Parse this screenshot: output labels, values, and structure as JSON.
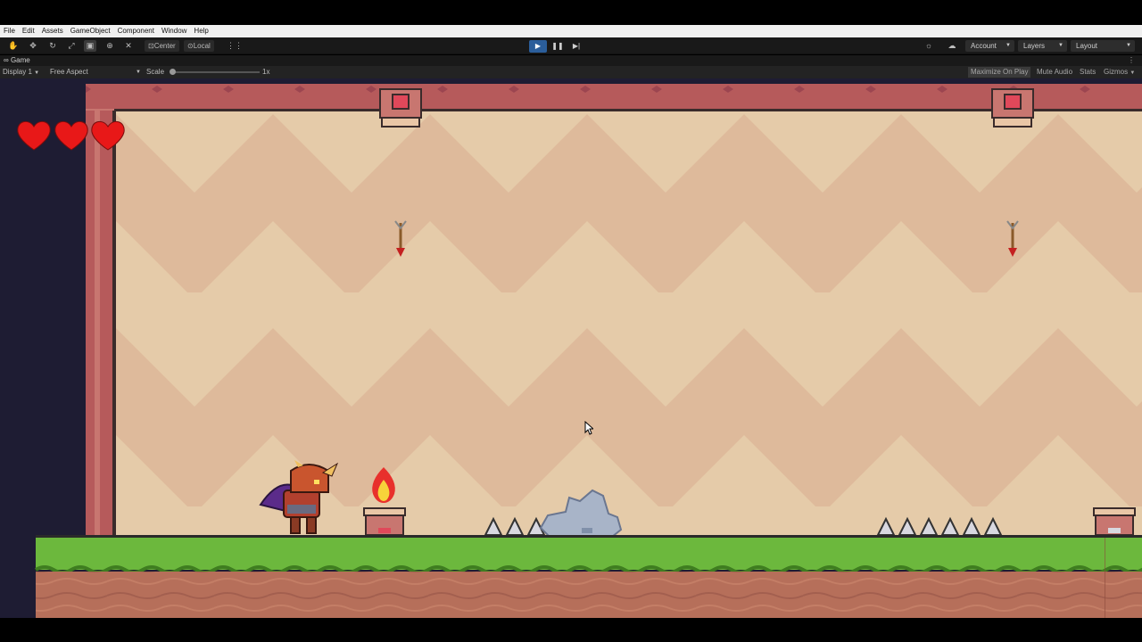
{
  "menu": {
    "items": [
      "File",
      "Edit",
      "Assets",
      "GameObject",
      "Component",
      "Window",
      "Help"
    ]
  },
  "toolbar": {
    "pivot_label": "Center",
    "space_label": "Local",
    "account_label": "Account",
    "layers_label": "Layers",
    "layout_label": "Layout"
  },
  "tab": {
    "title": "Game"
  },
  "game_toolbar": {
    "display": "Display 1",
    "aspect": "Free Aspect",
    "scale_label": "Scale",
    "scale_value": "1x",
    "maximize": "Maximize On Play",
    "mute": "Mute Audio",
    "stats": "Stats",
    "gizmos": "Gizmos"
  },
  "game": {
    "hearts": 3,
    "icons": [
      "heart-icon",
      "arrow-trap-icon",
      "arrow-projectile-icon",
      "fire-icon",
      "spike-trap-icon",
      "ghost-icon"
    ]
  },
  "colors": {
    "play_active": "#2b5e9b",
    "wall": "#b85d5d",
    "wall_bg": "#e3c9a7",
    "grass": "#6cb83d",
    "dirt": "#b76f5b",
    "heart": "#e81818"
  }
}
